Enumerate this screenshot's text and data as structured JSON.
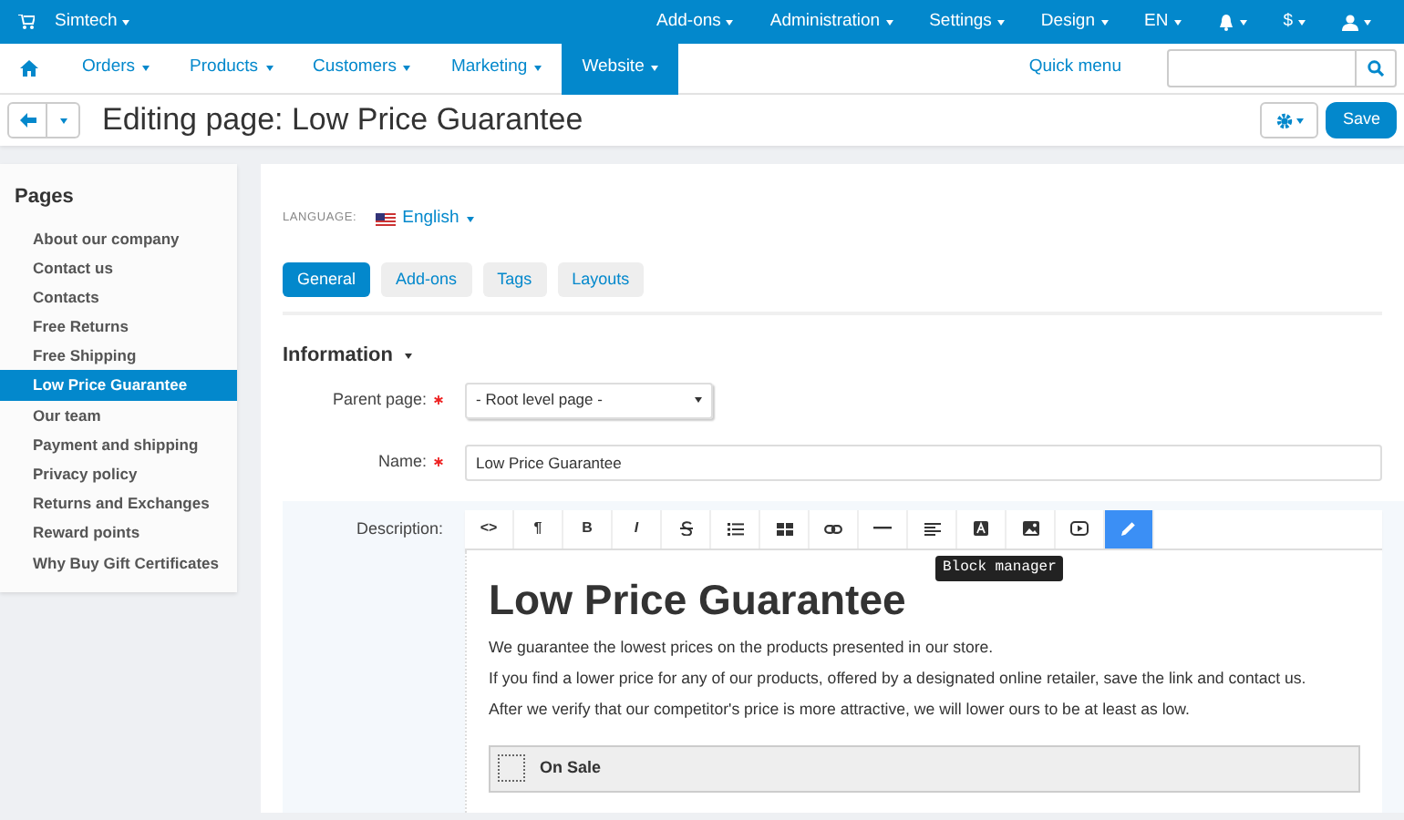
{
  "top_bar": {
    "brand": "Simtech",
    "menus": [
      {
        "kind": "text",
        "label": "Add-ons"
      },
      {
        "kind": "text",
        "label": "Administration"
      },
      {
        "kind": "text",
        "label": "Settings"
      },
      {
        "kind": "text",
        "label": "Design"
      },
      {
        "kind": "text",
        "label": "EN"
      },
      {
        "kind": "bell"
      },
      {
        "kind": "text",
        "label": "$"
      },
      {
        "kind": "user"
      }
    ]
  },
  "main_nav": {
    "items": [
      {
        "label": "Orders",
        "selected": false
      },
      {
        "label": "Products",
        "selected": false
      },
      {
        "label": "Customers",
        "selected": false
      },
      {
        "label": "Marketing",
        "selected": false
      },
      {
        "label": "Website",
        "selected": true
      }
    ],
    "quick_menu": "Quick menu"
  },
  "title": "Editing page: Low Price Guarantee",
  "save_button": "Save",
  "sidebar": {
    "title": "Pages",
    "items": [
      {
        "label": "About our company",
        "selected": false
      },
      {
        "label": "Contact us",
        "selected": false
      },
      {
        "label": "Contacts",
        "selected": false
      },
      {
        "label": "Free Returns",
        "selected": false
      },
      {
        "label": "Free Shipping",
        "selected": false
      },
      {
        "label": "Low Price Guarantee",
        "selected": true
      },
      {
        "label": "Our team",
        "selected": false
      },
      {
        "label": "Payment and shipping",
        "selected": false
      },
      {
        "label": "Privacy policy",
        "selected": false
      },
      {
        "label": "Returns and Exchanges",
        "selected": false
      },
      {
        "label": "Reward points",
        "selected": false
      },
      {
        "label": "Why Buy Gift Certificates",
        "selected": false
      }
    ]
  },
  "language": {
    "label": "LANGUAGE:",
    "value": "English"
  },
  "tabs": [
    {
      "label": "General",
      "selected": true
    },
    {
      "label": "Add-ons",
      "selected": false
    },
    {
      "label": "Tags",
      "selected": false
    },
    {
      "label": "Layouts",
      "selected": false
    }
  ],
  "section_title": "Information",
  "form": {
    "parent_page": {
      "label": "Parent page:",
      "required": true,
      "value": "- Root level page -"
    },
    "name": {
      "label": "Name:",
      "required": true,
      "value": "Low Price Guarantee"
    },
    "description": {
      "label": "Description:"
    }
  },
  "toolbar": [
    {
      "kind": "glyph",
      "label": "<>",
      "selected": false
    },
    {
      "kind": "glyph",
      "label": "¶",
      "selected": false
    },
    {
      "kind": "glyph",
      "label": "B",
      "selected": false
    },
    {
      "kind": "glyph",
      "label": "I",
      "selected": false
    },
    {
      "kind": "strike",
      "selected": false
    },
    {
      "kind": "list",
      "selected": false
    },
    {
      "kind": "table",
      "selected": false
    },
    {
      "kind": "link",
      "selected": false
    },
    {
      "kind": "rule",
      "selected": false
    },
    {
      "kind": "align",
      "selected": false
    },
    {
      "kind": "color",
      "selected": false
    },
    {
      "kind": "image",
      "selected": false
    },
    {
      "kind": "video",
      "selected": false
    },
    {
      "kind": "block",
      "selected": true
    }
  ],
  "tooltip": "Block manager",
  "editor": {
    "heading": "Low Price Guarantee",
    "paragraphs": [
      "We guarantee the lowest prices on the products presented in our store.",
      "If you find a lower price for any of our products, offered by a designated online retailer, save the link and contact us.",
      "After we verify that our competitor's price is more attractive, we will lower ours to be at least as low."
    ],
    "block": "On Sale"
  }
}
